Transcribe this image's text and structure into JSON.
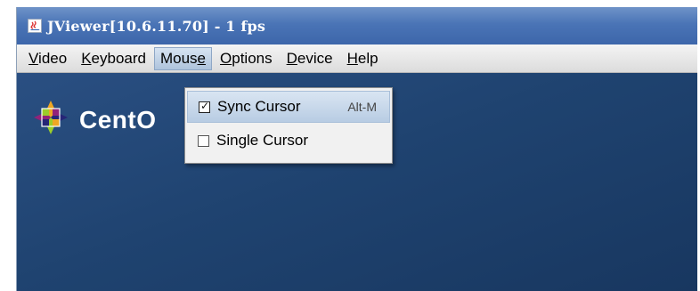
{
  "window": {
    "title": "JViewer[10.6.11.70] - 1 fps",
    "icon": "java-app-icon"
  },
  "menubar": {
    "items": [
      {
        "label": "Video",
        "mnemonic": "V",
        "rest": "ideo"
      },
      {
        "label": "Keyboard",
        "mnemonic": "K",
        "rest": "eyboard"
      },
      {
        "label": "Mouse",
        "pre": "Mous",
        "mnemonic": "e",
        "active": true
      },
      {
        "label": "Options",
        "mnemonic": "O",
        "rest": "ptions"
      },
      {
        "label": "Device",
        "mnemonic": "D",
        "rest": "evice"
      },
      {
        "label": "Help",
        "mnemonic": "H",
        "rest": "elp"
      }
    ]
  },
  "mouse_menu": {
    "items": [
      {
        "label": "Sync Cursor",
        "checked": true,
        "shortcut": "Alt-M",
        "highlighted": true
      },
      {
        "label": "Single Cursor",
        "checked": false,
        "shortcut": ""
      }
    ]
  },
  "desktop": {
    "logo_text": "CentO",
    "background_color": "#1f4370"
  },
  "colors": {
    "titlebar": "#4a74b6",
    "menubar": "#dcdcdc",
    "menu_highlight": "#b8cce3"
  }
}
